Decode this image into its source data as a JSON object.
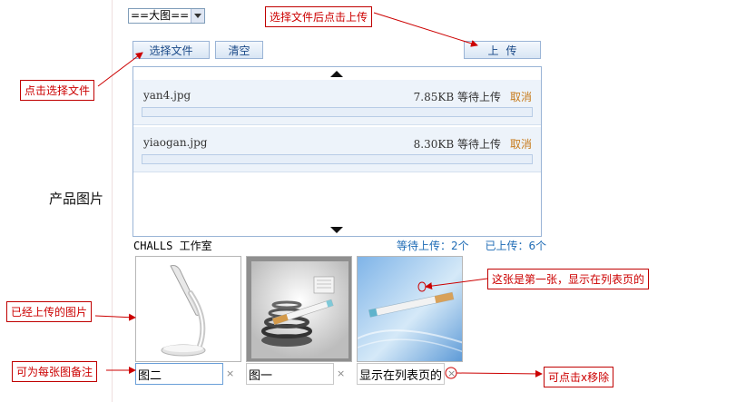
{
  "form": {
    "field_label": "产品图片",
    "size_select_value": "==大图=="
  },
  "toolbar": {
    "choose_label": "选择文件",
    "clear_label": "清空",
    "upload_label": "上传"
  },
  "queue": {
    "items": [
      {
        "name": "yan4.jpg",
        "size_status": "7.85KB 等待上传",
        "cancel": "取消",
        "progress": 0
      },
      {
        "name": "yiaogan.jpg",
        "size_status": "8.30KB 等待上传",
        "cancel": "取消",
        "progress": 0
      }
    ]
  },
  "status": {
    "studio": "CHALLS 工作室",
    "waiting": "等待上传：2个",
    "uploaded": "已上传：6个"
  },
  "gallery": {
    "items": [
      {
        "note": "图二",
        "remove": "×",
        "icon": "desk-lamp-image"
      },
      {
        "note": "图一",
        "remove": "×",
        "icon": "e-cigarette-spiral-image"
      },
      {
        "note": "显示在列表页的",
        "remove": "×",
        "icon": "e-cigarette-image"
      }
    ]
  },
  "annotations": {
    "upload": "选择文件后点击上传",
    "choose": "点击选择文件",
    "uploaded": "已经上传的图片",
    "first": "这张是第一张，显示在列表页的",
    "note": "可为每张图备注",
    "remove": "可点击x移除"
  },
  "colors": {
    "annotation": "#cc0000",
    "button_text": "#1b4a88",
    "status_text": "#1e6bb5",
    "cancel_text": "#c77a1a"
  }
}
